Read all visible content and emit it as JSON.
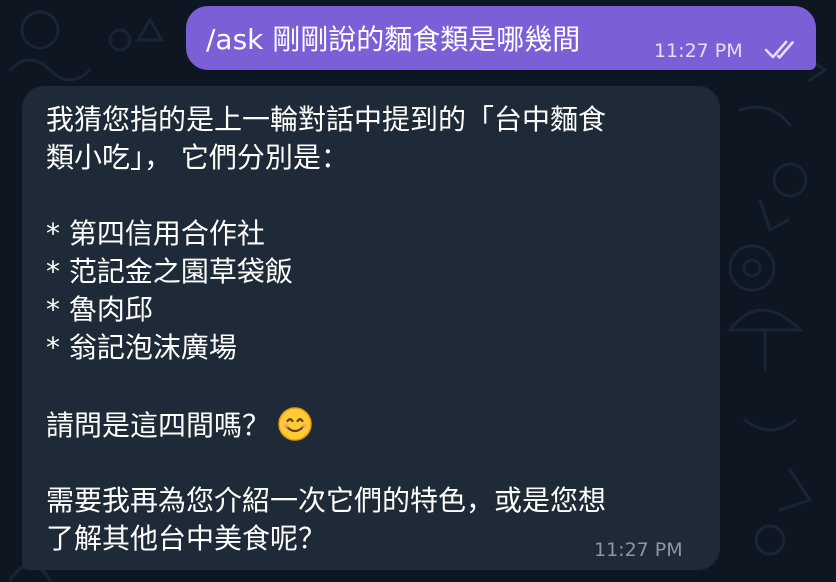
{
  "chat": {
    "outgoing": {
      "text": "/ask 剛剛說的麵食類是哪幾間",
      "time": "11:27 PM",
      "status_icon": "double-check-icon"
    },
    "incoming": {
      "lines": [
        "我猜您指的是上一輪對話中提到的「台中麵食",
        "類小吃」， 它們分別是：",
        "* 第四信用合作社",
        "* 范記金之園草袋飯",
        "* 魯肉邱",
        "* 翁記泡沫廣場",
        "請問是這四間嗎？",
        "需要我再為您介紹一次它們的特色，或是您想",
        "了解其他台中美食呢？"
      ],
      "emoji": "smiling-face-emoji",
      "time": "11:27 PM"
    }
  },
  "colors": {
    "background": "#0e1621",
    "outgoing_bubble": "#7b5fd6",
    "incoming_bubble": "#1e2a37",
    "text": "#ffffff",
    "incoming_time": "#8a97a6"
  }
}
